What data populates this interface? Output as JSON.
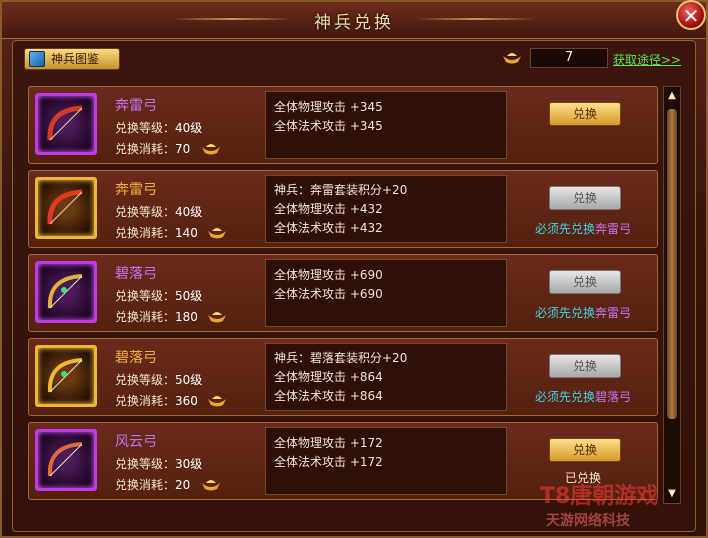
{
  "window": {
    "title": "神兵兑换",
    "close_label": "✕"
  },
  "header": {
    "atlas_label": "神兵图鉴",
    "currency_value": "7",
    "obtain_link": "获取途径>>"
  },
  "labels": {
    "level_prefix": "兑换等级：",
    "cost_prefix": "兑换消耗：",
    "redeem": "兑换"
  },
  "items": [
    {
      "name": "奔雷弓",
      "rarity": "purple",
      "level": "40级",
      "cost": "70",
      "stats": [
        "全体物理攻击 +345",
        "全体法术攻击 +345"
      ],
      "button_state": "active",
      "req_prefix": "",
      "req_item": "",
      "status": ""
    },
    {
      "name": "奔雷弓",
      "rarity": "gold",
      "level": "40级",
      "cost": "140",
      "stats": [
        "神兵：奔雷套装积分+20",
        "全体物理攻击 +432",
        "全体法术攻击 +432"
      ],
      "button_state": "disabled",
      "req_prefix": "必须先兑换",
      "req_item": "奔雷弓",
      "status": ""
    },
    {
      "name": "碧落弓",
      "rarity": "purple",
      "level": "50级",
      "cost": "180",
      "stats": [
        "全体物理攻击 +690",
        "全体法术攻击 +690"
      ],
      "button_state": "disabled",
      "req_prefix": "必须先兑换",
      "req_item": "奔雷弓",
      "status": ""
    },
    {
      "name": "碧落弓",
      "rarity": "gold",
      "level": "50级",
      "cost": "360",
      "stats": [
        "神兵：碧落套装积分+20",
        "全体物理攻击 +864",
        "全体法术攻击 +864"
      ],
      "button_state": "disabled",
      "req_prefix": "必须先兑换",
      "req_item": "碧落弓",
      "status": ""
    },
    {
      "name": "风云弓",
      "rarity": "purple",
      "level": "30级",
      "cost": "20",
      "stats": [
        "全体物理攻击 +172",
        "全体法术攻击 +172"
      ],
      "button_state": "active",
      "req_prefix": "",
      "req_item": "",
      "status": "已兑换"
    }
  ],
  "scrollbar": {
    "up": "▲",
    "down": "▼"
  },
  "watermark": {
    "main": "T8唐朝游戏",
    "sub": "天游网络科技"
  },
  "colors": {
    "purple_rarity": "#c873f0",
    "gold_rarity": "#f2b33b",
    "link_green": "#5fe84b",
    "requirement_cyan": "#3fd6e6"
  },
  "icons": {
    "close": "close-icon",
    "atlas": "book-icon",
    "currency": "gold-ingot-icon",
    "item": "bow-icon"
  }
}
